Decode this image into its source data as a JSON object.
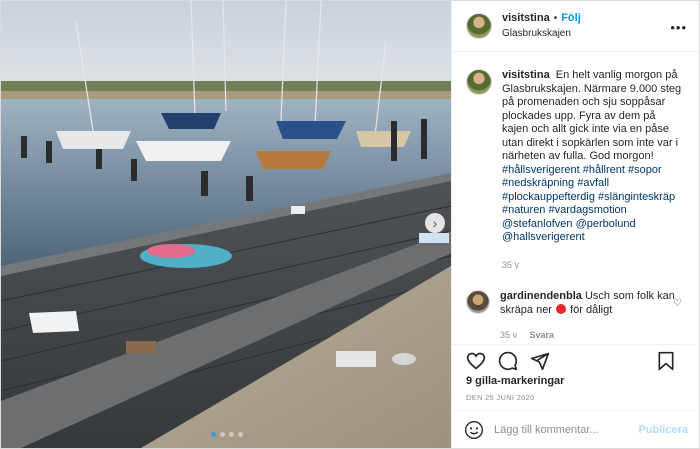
{
  "post": {
    "username": "visitstina",
    "follow_label": "Följ",
    "location": "Glasbrukskajen",
    "caption_text": "En helt vanlig morgon på Glasbrukskajen. Närmare 9.000 steg på promenaden och sju soppåsar plockades upp. Fyra av dem på kajen och allt gick inte via en påse utan direkt i sopkärlen som inte var i närheten av fulla. God morgon!",
    "hashtags": [
      "#hållsverigerent",
      "#hållrent",
      "#sopor",
      "#nedskräpning",
      "#avfall",
      "#plockauppefterdig",
      "#slänginteskräp",
      "#naturen",
      "#vardagsmotion"
    ],
    "mentions": [
      "@stefanlofven",
      "@perbolund",
      "@hallsverigerent"
    ],
    "caption_age": "35 v"
  },
  "comment": {
    "username": "gardinendenbla",
    "text_before": "Usch som folk kan skräpa ner",
    "text_after": "för dåligt",
    "age": "35 v",
    "reply_label": "Svara"
  },
  "likes_text": "9 gilla-markeringar",
  "date_text": "DEN 25 JUNI 2020",
  "add_comment": {
    "placeholder": "Lägg till kommentar...",
    "publish_label": "Publicera"
  },
  "carousel": {
    "count": 4,
    "active": 0
  },
  "icons": {
    "like": "heart-icon",
    "comment": "comment-icon",
    "share": "share-icon",
    "save": "bookmark-icon",
    "emoji": "smiley-icon",
    "next": "chevron-right-icon",
    "more": "more-icon"
  },
  "colors": {
    "link": "#00376b",
    "follow": "#0095f6",
    "publish_disabled": "#b2dffc"
  }
}
